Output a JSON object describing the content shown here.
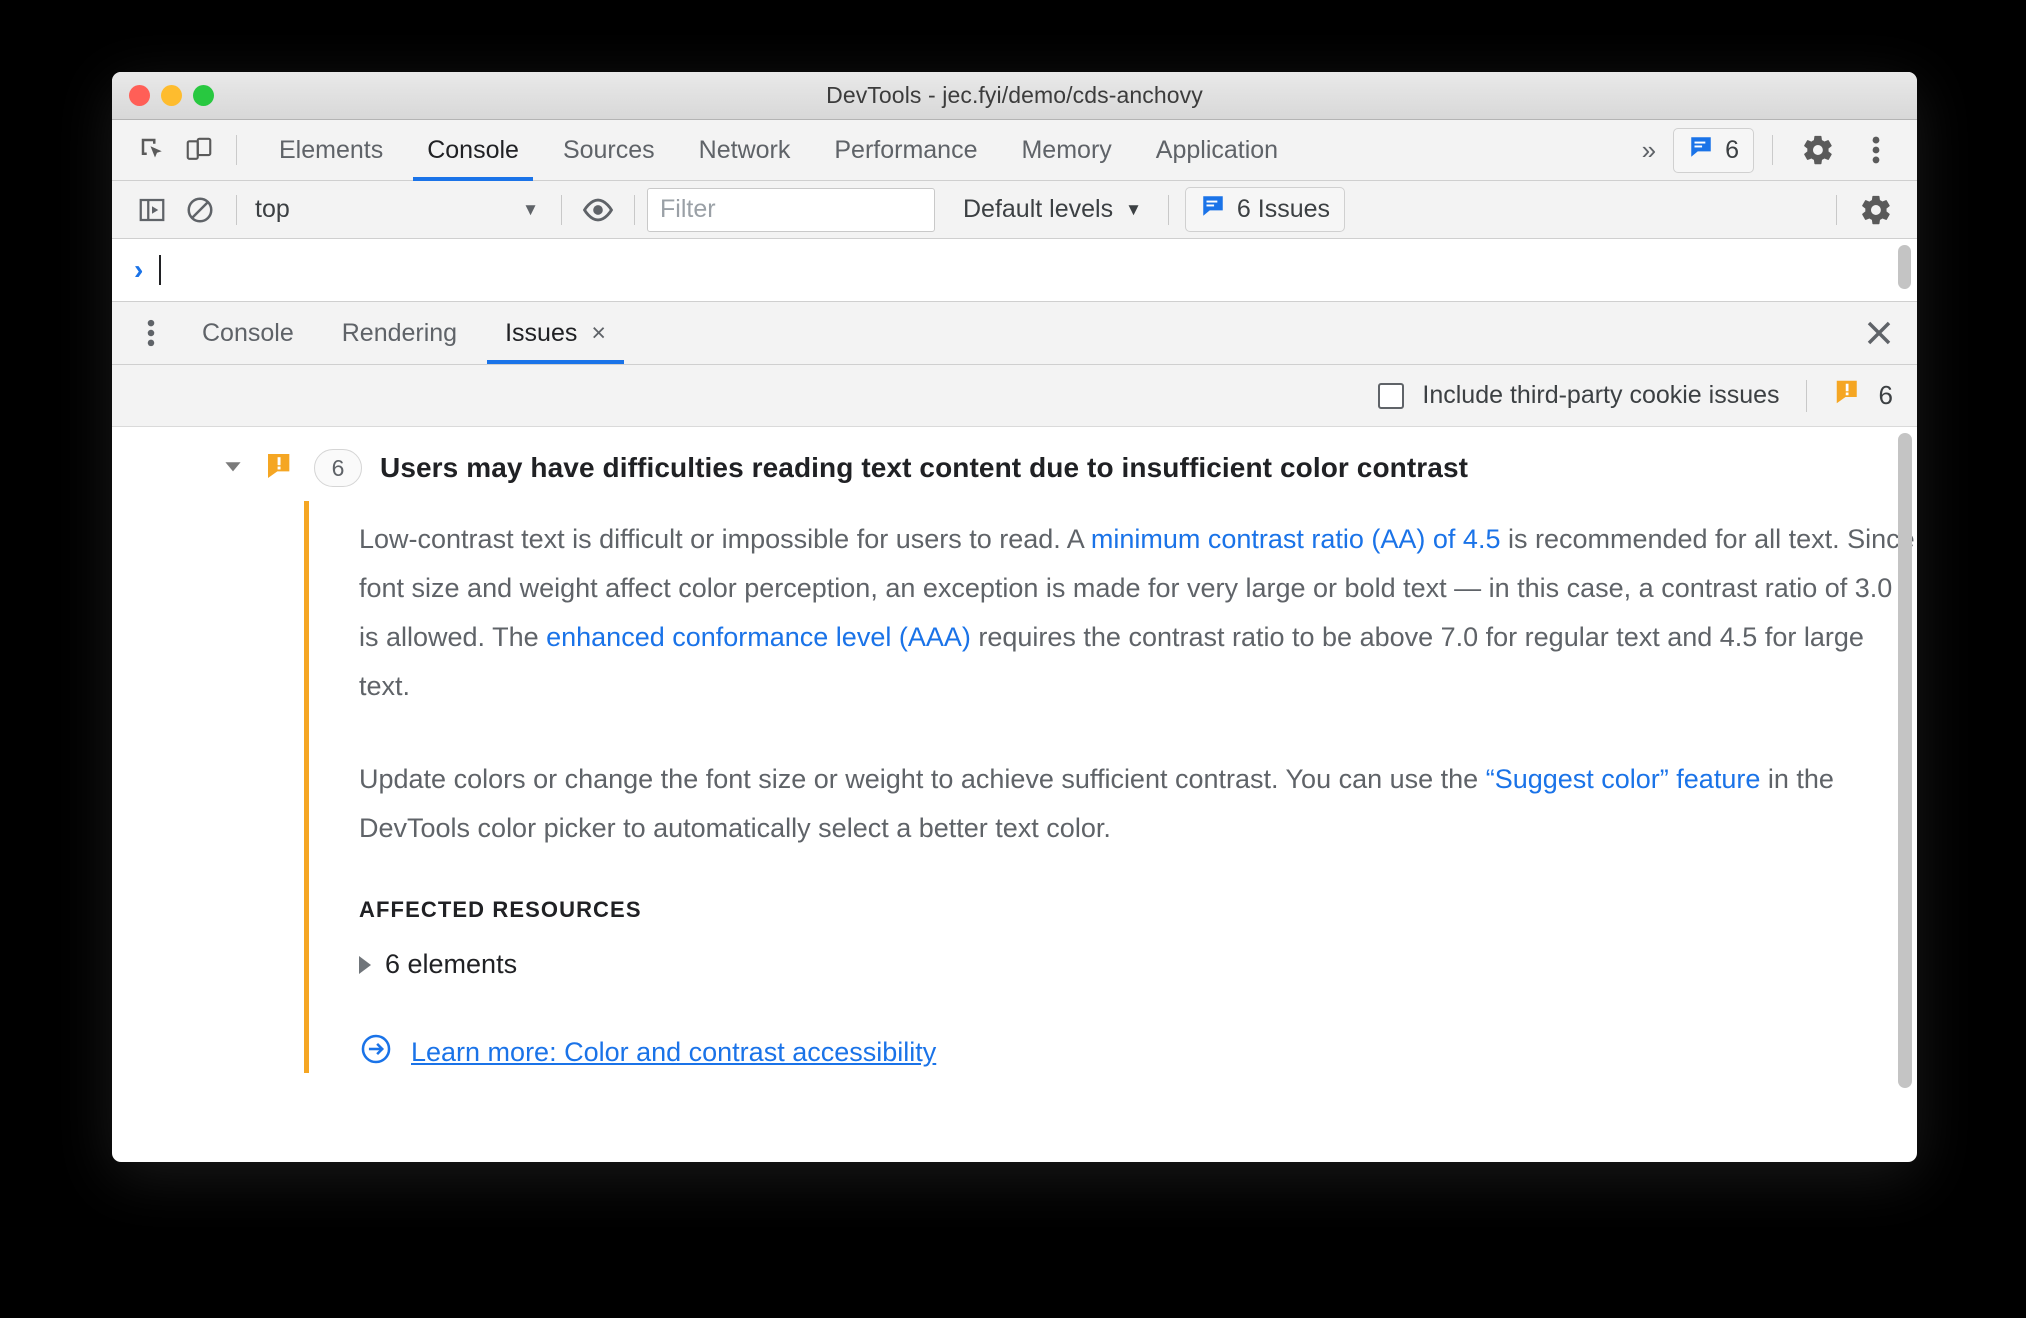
{
  "window": {
    "title": "DevTools - jec.fyi/demo/cds-anchovy",
    "traffic_lights": [
      "close",
      "minimize",
      "zoom"
    ]
  },
  "main_tabbar": {
    "icons": [
      "inspect-element-icon",
      "device-toolbar-icon"
    ],
    "tabs": [
      {
        "label": "Elements",
        "active": false
      },
      {
        "label": "Console",
        "active": true
      },
      {
        "label": "Sources",
        "active": false
      },
      {
        "label": "Network",
        "active": false
      },
      {
        "label": "Performance",
        "active": false
      },
      {
        "label": "Memory",
        "active": false
      },
      {
        "label": "Application",
        "active": false
      }
    ],
    "overflow_label": "»",
    "issues_chip_count": "6",
    "settings_icon": "gear-icon",
    "more_icon": "kebab-icon",
    "accent": "#1a73e8"
  },
  "console_toolbar": {
    "sidebar_toggle": "console-sidebar-icon",
    "clear_console": "clear-console-icon",
    "context": "top",
    "context_caret": "▼",
    "eye_icon": "live-expression-icon",
    "filter_placeholder": "Filter",
    "filter_value": "",
    "levels_label": "Default levels",
    "levels_caret": "▼",
    "issues_button_label": "6 Issues",
    "settings_icon": "gear-icon"
  },
  "console_prompt": {
    "arrow": "›",
    "value": ""
  },
  "drawer": {
    "more_icon": "kebab-icon",
    "tabs": [
      {
        "label": "Console",
        "active": false,
        "closeable": false
      },
      {
        "label": "Rendering",
        "active": false,
        "closeable": false
      },
      {
        "label": "Issues",
        "active": true,
        "closeable": true,
        "close_glyph": "×"
      }
    ],
    "close_drawer_glyph": "✕"
  },
  "issues_toolbar": {
    "cookie_checkbox_label": "Include third-party cookie issues",
    "cookie_checkbox_checked": false,
    "warning_icon": "warning-badge-icon",
    "warning_count": "6",
    "warning_color": "#f5a623"
  },
  "issue": {
    "expanded": true,
    "expand_glyph": "▼",
    "severity_icon": "warning-badge-icon",
    "count": "6",
    "title": "Users may have difficulties reading text content due to insufficient color contrast",
    "paragraph_1_part_1": "Low-contrast text is difficult or impossible for users to read. A ",
    "paragraph_1_link_1": "minimum contrast ratio (AA) of 4.5",
    "paragraph_1_part_2": " is recommended for all text. Since font size and weight affect color perception, an exception is made for very large or bold text — in this case, a contrast ratio of 3.0 is allowed. The ",
    "paragraph_1_link_2": "enhanced conformance level (AAA)",
    "paragraph_1_part_3": " requires the contrast ratio to be above 7.0 for regular text and 4.5 for large text.",
    "paragraph_2_part_1": "Update colors or change the font size or weight to achieve sufficient contrast. You can use the ",
    "paragraph_2_link_1": "“Suggest color” feature",
    "paragraph_2_part_2": " in the DevTools color picker to automatically select a better text color.",
    "affected_resources_heading": "AFFECTED RESOURCES",
    "affected_resource_row": "6 elements",
    "affected_expand_glyph": "▶",
    "learn_more_icon": "arrow-circle-icon",
    "learn_more_label": "Learn more: Color and contrast accessibility"
  }
}
